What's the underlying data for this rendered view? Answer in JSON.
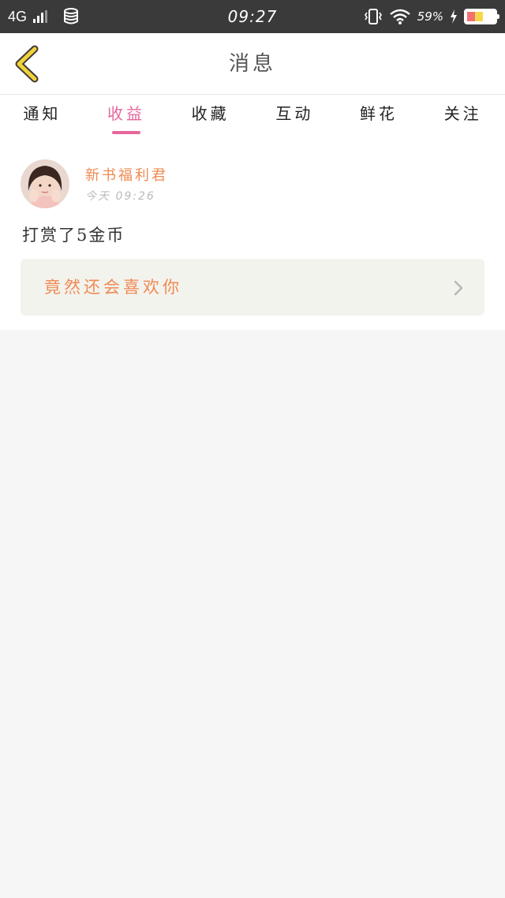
{
  "status_bar": {
    "network": "4G",
    "time": "09:27",
    "battery_percent": "59%",
    "icons": [
      "signal-icon",
      "database-icon",
      "vibrate-icon",
      "wifi-icon",
      "charging-icon",
      "battery-icon"
    ]
  },
  "header": {
    "title": "消息",
    "back_icon": "chevron-left-icon",
    "back_color": "#f2d23a"
  },
  "tabs": {
    "items": [
      {
        "label": "通知"
      },
      {
        "label": "收益"
      },
      {
        "label": "收藏"
      },
      {
        "label": "互动"
      },
      {
        "label": "鲜花"
      },
      {
        "label": "关注"
      }
    ],
    "active_index": 1,
    "accent_color": "#e6669c"
  },
  "message": {
    "sender": "新书福利君",
    "timestamp": "今天 09:26",
    "body": "打赏了5金币",
    "quote": "竟然还会喜欢你",
    "quote_icon": "chevron-right-icon",
    "accent_color": "#f08a52"
  }
}
